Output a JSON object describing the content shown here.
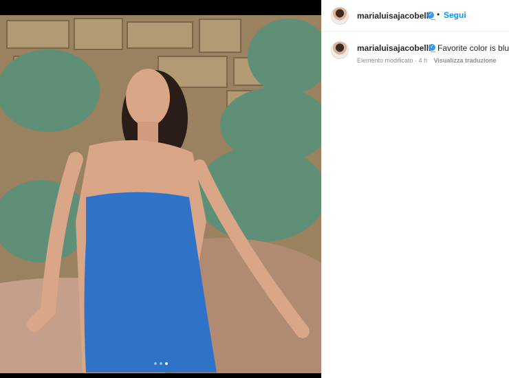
{
  "post": {
    "username": "marialuisajacobelli_",
    "separator": "•",
    "follow_label": "Segui",
    "verified_icon": "verified-badge-icon",
    "carousel": {
      "total": 3,
      "active": 3
    }
  },
  "caption": {
    "username": "marialuisajacobelli_",
    "text": "Favorite color is blue",
    "edited": "Elemento modificato",
    "time": "· 4 h",
    "translate_label": "Visualizza traduzione"
  },
  "colors": {
    "accent": "#0095f6",
    "verified": "#3897f0",
    "text": "#262626",
    "muted": "#8e8e8e"
  }
}
